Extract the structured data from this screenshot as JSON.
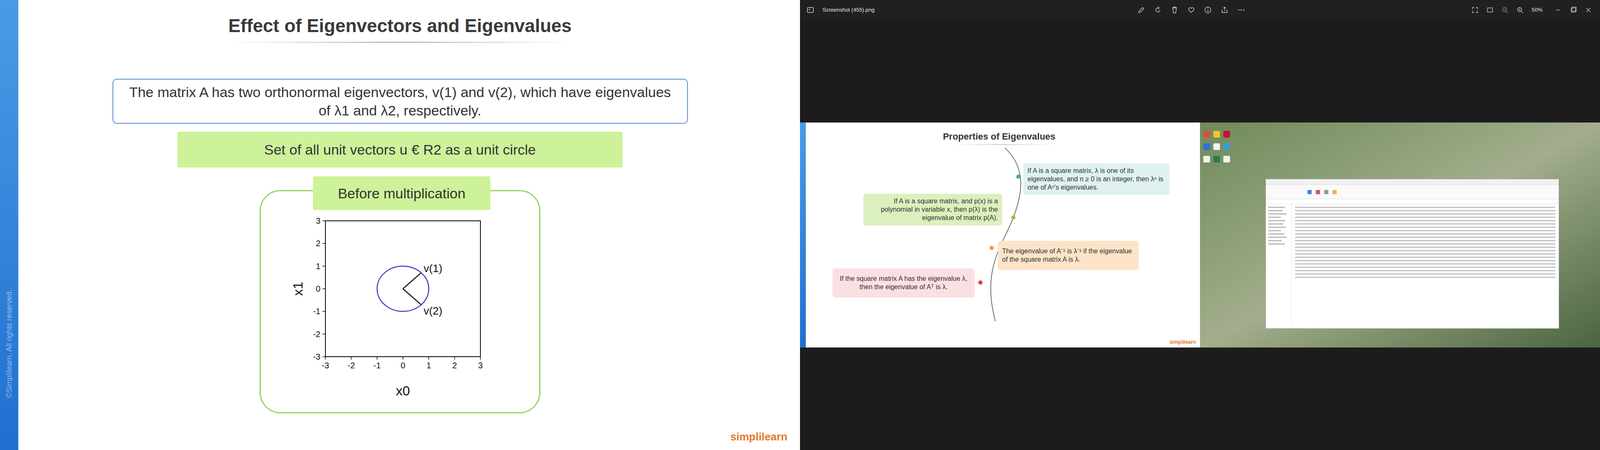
{
  "slide": {
    "watermark": "©Simplilearn. All rights reserved.",
    "title": "Effect of Eigenvectors and Eigenvalues",
    "statement": "The matrix A has two orthonormal eigenvectors, v(1) and v(2), which have eigenvalues of λ1 and λ2, respectively.",
    "subtitle": "Set of all unit vectors u € R2 as a unit circle",
    "card_title": "Before multiplication",
    "chart": {
      "x_label": "x0",
      "y_label": "x1",
      "x_ticks": [
        "-3",
        "-2",
        "-1",
        "0",
        "1",
        "2",
        "3"
      ],
      "y_ticks": [
        "3",
        "2",
        "1",
        "0",
        "-1",
        "-2",
        "-3"
      ],
      "circle_radius": 1,
      "vectors": [
        {
          "label": "v(1)",
          "x": 0.707,
          "y": 0.707
        },
        {
          "label": "v(2)",
          "x": 0.707,
          "y": -0.707
        }
      ]
    },
    "logo": "simplilearn"
  },
  "viewer": {
    "file_name": "Screenshot (455).png",
    "zoom": "50%",
    "inner_slide": {
      "title": "Properties of Eigenvalues",
      "logo": "simplilearn",
      "notes": [
        {
          "text": "If A is a square matrix, λ is one of its eigenvalues, and n ≥ 0 is an integer, then λⁿ is one of Aⁿ's eigenvalues.",
          "color": "#dff2f1",
          "dot_color": "#2bb3a6"
        },
        {
          "text": "If A is a square matrix, and p(x) is a polynomial in variable x, then p(λ) is the eigenvalue of matrix p(A).",
          "color": "#dcf0bd",
          "dot_color": "#8cc63f"
        },
        {
          "text": "The eigenvalue of A⁻¹ is λ⁻¹ if the eigenvalue of the square matrix A is λ.",
          "color": "#fde4c8",
          "dot_color": "#f39a2d"
        },
        {
          "text": "If the square matrix A has the eigenvalue λ, then the eigenvalue of Aᵀ is λ.",
          "color": "#fbe0e3",
          "dot_color": "#e23b3b"
        }
      ]
    }
  }
}
